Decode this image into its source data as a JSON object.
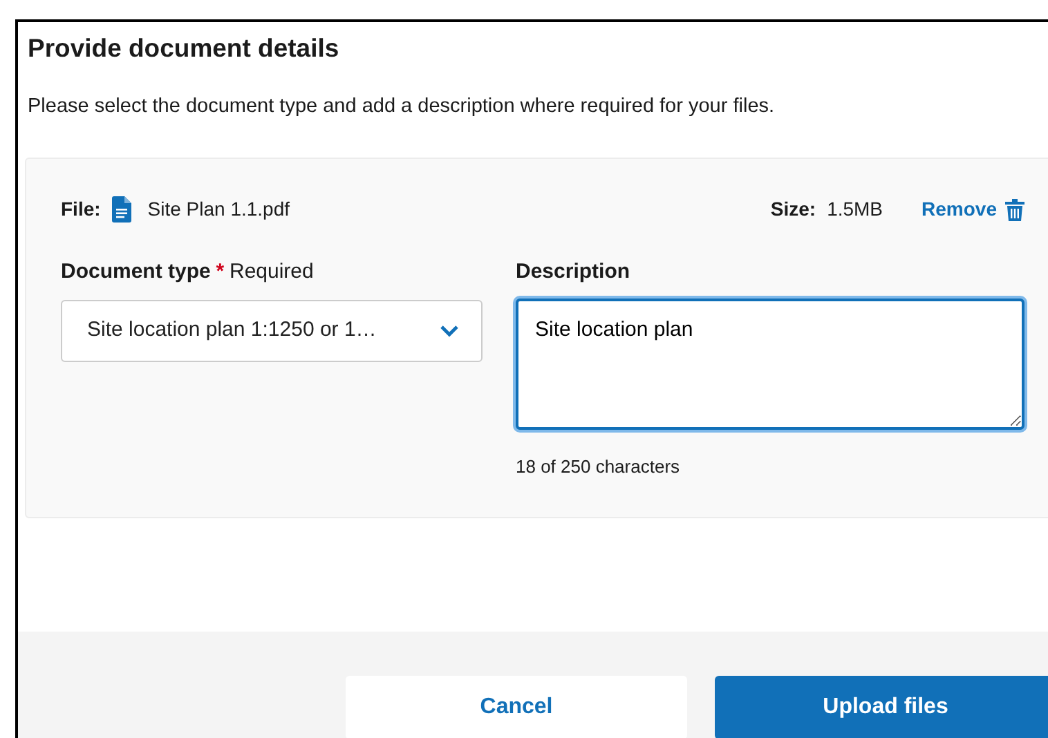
{
  "dialog": {
    "title": "Provide document details",
    "intro": "Please select the document type and add a description where required for your files."
  },
  "file": {
    "label": "File:",
    "name": "Site Plan 1.1.pdf",
    "size_label": "Size:",
    "size": "1.5MB",
    "remove": "Remove",
    "document_type": {
      "label": "Document type",
      "required_mark": "*",
      "required_text": "Required",
      "value": "Site location plan 1:1250 or 1…"
    },
    "description": {
      "label": "Description",
      "value": "Site location plan",
      "focused": true,
      "counter": "18 of 250 characters"
    }
  },
  "buttons": [
    {
      "label": "Cancel",
      "kind": "secondary"
    },
    {
      "label": "Upload files",
      "kind": "primary"
    }
  ]
}
